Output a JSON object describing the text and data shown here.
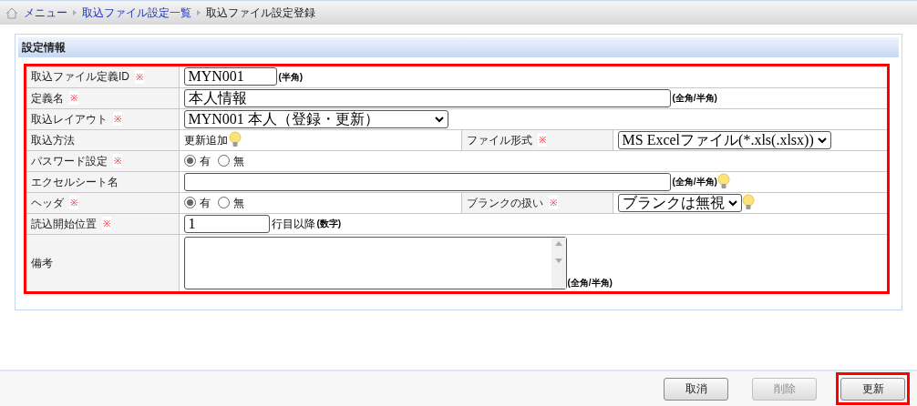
{
  "breadcrumb": [
    {
      "label": "メニュー",
      "link": true
    },
    {
      "label": "取込ファイル設定一覧",
      "link": true
    },
    {
      "label": "取込ファイル設定登録",
      "link": false
    }
  ],
  "section_title": "設定情報",
  "form_highlighted": true,
  "rows": [
    {
      "fields": [
        {
          "label": "取込ファイル定義ID",
          "required_mark": "※",
          "control": {
            "kind": "text",
            "value": "MYN001",
            "note": "(半角)",
            "hint": false
          }
        }
      ]
    },
    {
      "fields": [
        {
          "label": "定義名",
          "required_mark": "※",
          "control": {
            "kind": "text",
            "value": "本人情報",
            "note": "(全角/半角)",
            "hint": false
          }
        }
      ]
    },
    {
      "fields": [
        {
          "label": "取込レイアウト",
          "required_mark": "※",
          "control": {
            "kind": "select",
            "value": "MYN001 本人（登録・更新）",
            "hint": false
          }
        }
      ]
    },
    {
      "fields": [
        {
          "label": "取込方法",
          "control": {
            "kind": "static",
            "value": "更新追加",
            "hint": true
          }
        },
        {
          "label": "ファイル形式",
          "required_mark": "※",
          "control": {
            "kind": "select",
            "value": "MS Excelファイル(*.xls(.xlsx))",
            "hint": false
          }
        }
      ]
    },
    {
      "fields": [
        {
          "label": "パスワード設定",
          "required_mark": "※",
          "control": {
            "kind": "radio",
            "options": [
              {
                "label": "有",
                "selected": true
              },
              {
                "label": "無",
                "selected": false
              }
            ]
          }
        }
      ]
    },
    {
      "fields": [
        {
          "label": "エクセルシート名",
          "control": {
            "kind": "text",
            "note": "(全角/半角)",
            "hint": true
          }
        }
      ]
    },
    {
      "fields": [
        {
          "label": "ヘッダ",
          "required_mark": "※",
          "control": {
            "kind": "radio",
            "options": [
              {
                "label": "有",
                "selected": true
              },
              {
                "label": "無",
                "selected": false
              }
            ]
          }
        },
        {
          "label": "ブランクの扱い",
          "required_mark": "※",
          "control": {
            "kind": "select",
            "value": "ブランクは無視",
            "hint": true
          }
        }
      ]
    },
    {
      "fields": [
        {
          "label": "読込開始位置",
          "required_mark": "※",
          "control": {
            "kind": "text",
            "value": "1",
            "suffix": "行目以降",
            "note": "(数字)",
            "hint": false
          }
        }
      ]
    },
    {
      "fields": [
        {
          "label": "備考",
          "control": {
            "kind": "textarea",
            "note": "(全角/半角)"
          }
        }
      ]
    }
  ],
  "buttons": [
    {
      "label": "取消",
      "disabled": false,
      "highlighted": false
    },
    {
      "label": "削除",
      "disabled": true,
      "highlighted": false
    },
    {
      "label": "更新",
      "disabled": false,
      "highlighted": true
    }
  ]
}
